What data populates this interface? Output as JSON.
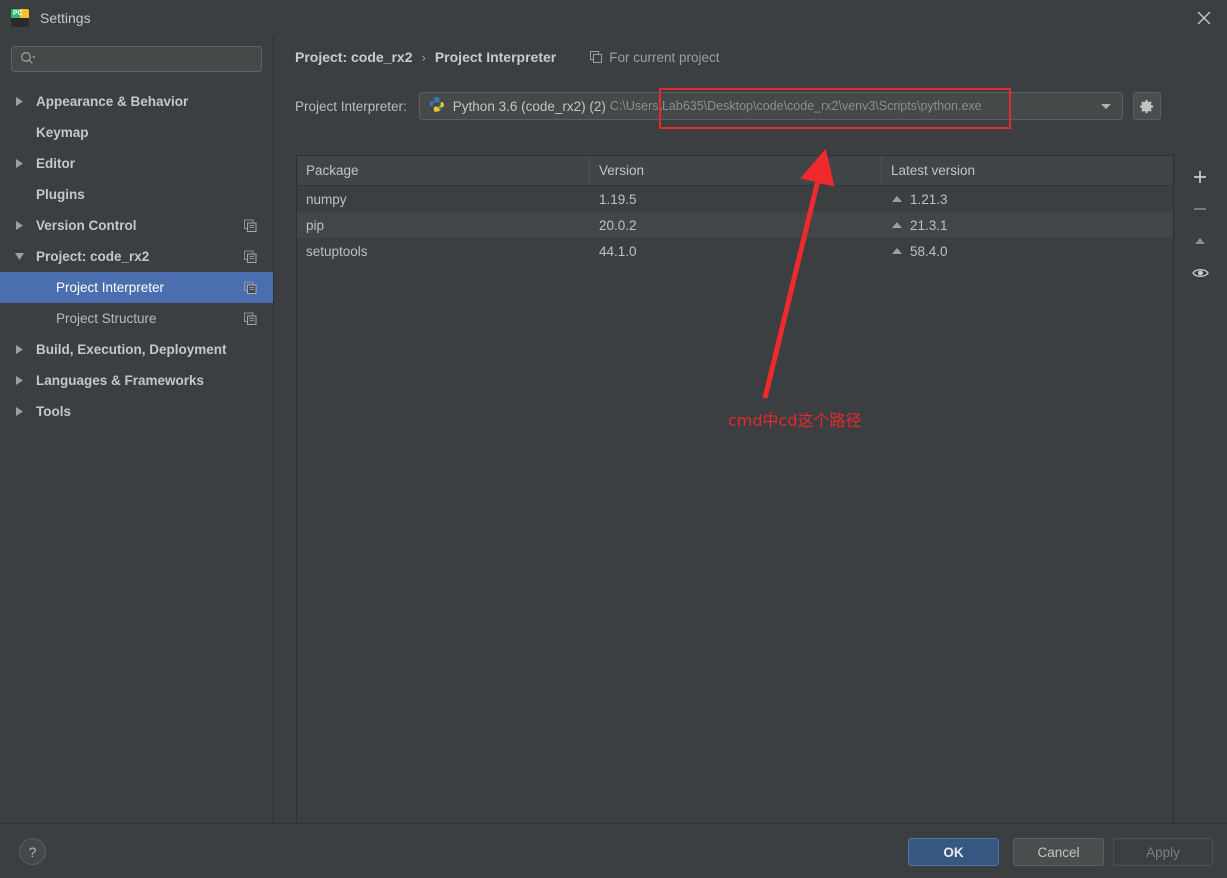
{
  "window": {
    "title": "Settings",
    "app_icon": "pycharm-icon",
    "close_icon": "close-icon"
  },
  "sidebar": {
    "search": {
      "placeholder": "",
      "value": "",
      "icon": "search-icon"
    },
    "items": [
      {
        "label": "Appearance & Behavior",
        "twisty": "collapsed",
        "bold": true,
        "indent": false,
        "copy": false,
        "selected": false
      },
      {
        "label": "Keymap",
        "twisty": "none",
        "bold": true,
        "indent": false,
        "copy": false,
        "selected": false
      },
      {
        "label": "Editor",
        "twisty": "collapsed",
        "bold": true,
        "indent": false,
        "copy": false,
        "selected": false
      },
      {
        "label": "Plugins",
        "twisty": "none",
        "bold": true,
        "indent": false,
        "copy": false,
        "selected": false
      },
      {
        "label": "Version Control",
        "twisty": "collapsed",
        "bold": true,
        "indent": false,
        "copy": true,
        "selected": false
      },
      {
        "label": "Project: code_rx2",
        "twisty": "expanded",
        "bold": true,
        "indent": false,
        "copy": true,
        "selected": false
      },
      {
        "label": "Project Interpreter",
        "twisty": "none",
        "bold": false,
        "indent": true,
        "copy": true,
        "selected": true
      },
      {
        "label": "Project Structure",
        "twisty": "none",
        "bold": false,
        "indent": true,
        "copy": true,
        "selected": false
      },
      {
        "label": "Build, Execution, Deployment",
        "twisty": "collapsed",
        "bold": true,
        "indent": false,
        "copy": false,
        "selected": false
      },
      {
        "label": "Languages & Frameworks",
        "twisty": "collapsed",
        "bold": true,
        "indent": false,
        "copy": false,
        "selected": false
      },
      {
        "label": "Tools",
        "twisty": "collapsed",
        "bold": true,
        "indent": false,
        "copy": false,
        "selected": false
      }
    ]
  },
  "main": {
    "breadcrumb": {
      "parent": "Project: code_rx2",
      "separator": "›",
      "current": "Project Interpreter",
      "scope_label": "For current project",
      "scope_icon": "copy-icon"
    },
    "interpreter": {
      "label": "Project Interpreter:",
      "icon": "python-venv-icon",
      "name": "Python 3.6 (code_rx2) (2)",
      "path": "C:\\Users\\Lab635\\Desktop\\code\\code_rx2\\venv3\\Scripts\\python.exe",
      "dropdown_icon": "chevron-down-icon",
      "settings_icon": "gear-icon"
    },
    "packages_table": {
      "columns": [
        "Package",
        "Version",
        "Latest version"
      ],
      "rows": [
        {
          "package": "numpy",
          "version": "1.19.5",
          "latest": "1.21.3",
          "upgrade": true
        },
        {
          "package": "pip",
          "version": "20.0.2",
          "latest": "21.3.1",
          "upgrade": true
        },
        {
          "package": "setuptools",
          "version": "44.1.0",
          "latest": "58.4.0",
          "upgrade": true
        }
      ]
    },
    "table_tools": [
      {
        "name": "add-package-button",
        "icon": "plus-icon"
      },
      {
        "name": "remove-package-button",
        "icon": "minus-icon"
      },
      {
        "name": "upgrade-package-button",
        "icon": "up-triangle-icon"
      },
      {
        "name": "show-early-releases-button",
        "icon": "eye-icon"
      }
    ]
  },
  "annotation": {
    "text": "cmd中cd这个路径",
    "color": "#e8282b"
  },
  "footer": {
    "help_label": "?",
    "ok_label": "OK",
    "cancel_label": "Cancel",
    "apply_label": "Apply"
  },
  "colors": {
    "background": "#3c3f41",
    "selection": "#4b6eaf",
    "primary_button": "#365880",
    "annotation_red": "#e8282b"
  }
}
